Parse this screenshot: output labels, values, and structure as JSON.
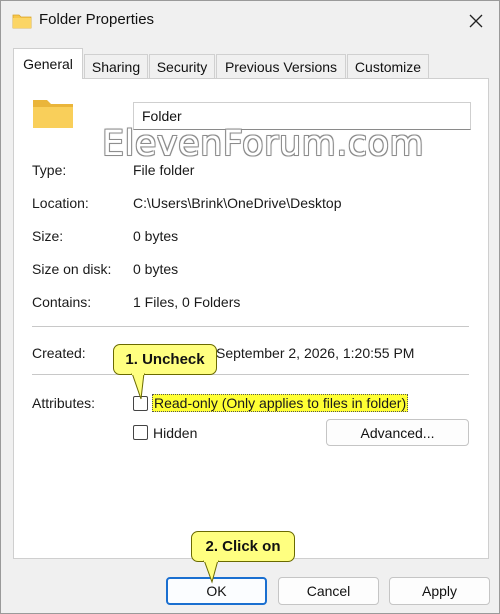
{
  "window": {
    "title": "Folder Properties"
  },
  "tabs": [
    {
      "label": "General",
      "active": true
    },
    {
      "label": "Sharing",
      "active": false
    },
    {
      "label": "Security",
      "active": false
    },
    {
      "label": "Previous Versions",
      "active": false
    },
    {
      "label": "Customize",
      "active": false
    }
  ],
  "general": {
    "name_value": "Folder",
    "watermark": "ElevenForum.com",
    "rows": [
      {
        "label": "Type:",
        "value": "File folder"
      },
      {
        "label": "Location:",
        "value": "C:\\Users\\Brink\\OneDrive\\Desktop"
      },
      {
        "label": "Size:",
        "value": "0 bytes"
      },
      {
        "label": "Size on disk:",
        "value": "0 bytes"
      },
      {
        "label": "Contains:",
        "value": "1 Files, 0 Folders"
      }
    ],
    "created_label": "Created:",
    "created_value": "September 2, 2026, 1:20:55 PM",
    "attributes_label": "Attributes:",
    "readonly_label": "Read-only (Only applies to files in folder)",
    "hidden_label": "Hidden",
    "advanced_label": "Advanced..."
  },
  "buttons": {
    "ok": "OK",
    "cancel": "Cancel",
    "apply": "Apply"
  },
  "callouts": {
    "step1": "1. Uncheck",
    "step2": "2. Click on"
  },
  "colors": {
    "folder": "#f7c64a",
    "callout": "#ffff80",
    "highlight": "#ffff33",
    "primary_border": "#1a6fd0"
  },
  "icons": {
    "title": "folder-icon",
    "close": "close-icon",
    "big": "folder-icon"
  }
}
